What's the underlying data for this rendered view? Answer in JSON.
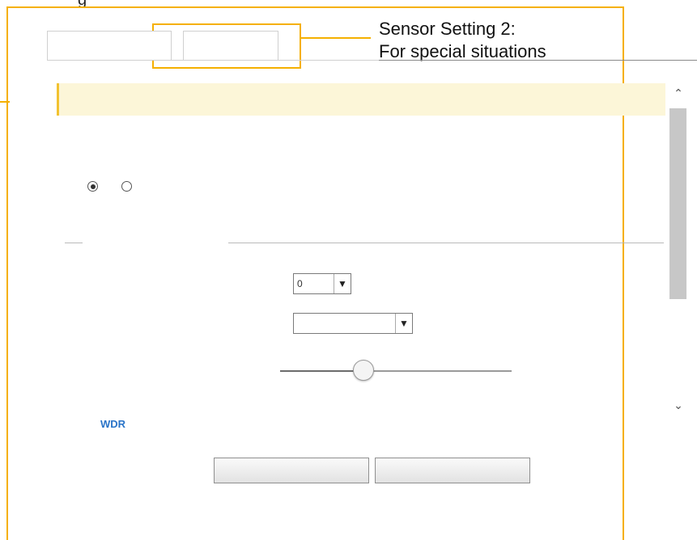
{
  "caption": {
    "top_fragment": "g",
    "callout_line1": "Sensor Setting 2:",
    "callout_line2": "For special situations"
  },
  "tabs": [
    {
      "label": "",
      "active": true
    },
    {
      "label": "",
      "active": false
    }
  ],
  "banner": {
    "text": ""
  },
  "measurement": {
    "title": "",
    "options": [
      {
        "label": "",
        "checked": true
      },
      {
        "label": "",
        "checked": false
      }
    ]
  },
  "exposure": {
    "legend": "",
    "level": {
      "label": "",
      "value": "0"
    },
    "mode": {
      "label": "",
      "value": ""
    },
    "gain": {
      "label": "",
      "value_text": "",
      "value_fraction": 0.36
    }
  },
  "wdr": {
    "title": "WDR"
  },
  "buttons": {
    "restore": "",
    "save": ""
  },
  "icons": {
    "select_arrow": "chevron-down-icon",
    "scroll_up": "chevron-up-icon",
    "scroll_down": "chevron-down-icon"
  },
  "colors": {
    "accent": "#2a74c8",
    "callout": "#f5b000",
    "banner_bg": "#fcf6d8",
    "banner_bar": "#f2c230"
  }
}
